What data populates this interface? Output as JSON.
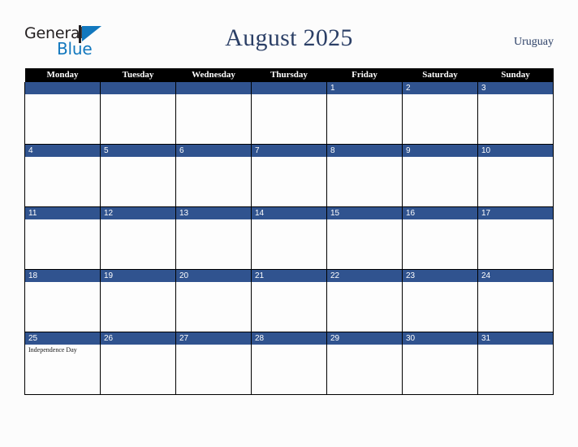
{
  "brand": {
    "logo_text_top": "General",
    "logo_text_bottom": "Blue",
    "logo_mark_icon": "triangle-play-icon",
    "accent_color": "#1278be",
    "dark_color": "#231f20"
  },
  "header": {
    "title": "August 2025",
    "country": "Uruguay",
    "title_color": "#2b3f66"
  },
  "calendar": {
    "weekday_headers": [
      "Monday",
      "Tuesday",
      "Wednesday",
      "Thursday",
      "Friday",
      "Saturday",
      "Sunday"
    ],
    "header_bg": "#000000",
    "date_bar_bg": "#30538f",
    "date_text_color": "#ffffff",
    "weeks": [
      [
        {
          "date": "",
          "events": []
        },
        {
          "date": "",
          "events": []
        },
        {
          "date": "",
          "events": []
        },
        {
          "date": "",
          "events": []
        },
        {
          "date": "1",
          "events": []
        },
        {
          "date": "2",
          "events": []
        },
        {
          "date": "3",
          "events": []
        }
      ],
      [
        {
          "date": "4",
          "events": []
        },
        {
          "date": "5",
          "events": []
        },
        {
          "date": "6",
          "events": []
        },
        {
          "date": "7",
          "events": []
        },
        {
          "date": "8",
          "events": []
        },
        {
          "date": "9",
          "events": []
        },
        {
          "date": "10",
          "events": []
        }
      ],
      [
        {
          "date": "11",
          "events": []
        },
        {
          "date": "12",
          "events": []
        },
        {
          "date": "13",
          "events": []
        },
        {
          "date": "14",
          "events": []
        },
        {
          "date": "15",
          "events": []
        },
        {
          "date": "16",
          "events": []
        },
        {
          "date": "17",
          "events": []
        }
      ],
      [
        {
          "date": "18",
          "events": []
        },
        {
          "date": "19",
          "events": []
        },
        {
          "date": "20",
          "events": []
        },
        {
          "date": "21",
          "events": []
        },
        {
          "date": "22",
          "events": []
        },
        {
          "date": "23",
          "events": []
        },
        {
          "date": "24",
          "events": []
        }
      ],
      [
        {
          "date": "25",
          "events": [
            "Independence Day"
          ]
        },
        {
          "date": "26",
          "events": []
        },
        {
          "date": "27",
          "events": []
        },
        {
          "date": "28",
          "events": []
        },
        {
          "date": "29",
          "events": []
        },
        {
          "date": "30",
          "events": []
        },
        {
          "date": "31",
          "events": []
        }
      ]
    ]
  }
}
